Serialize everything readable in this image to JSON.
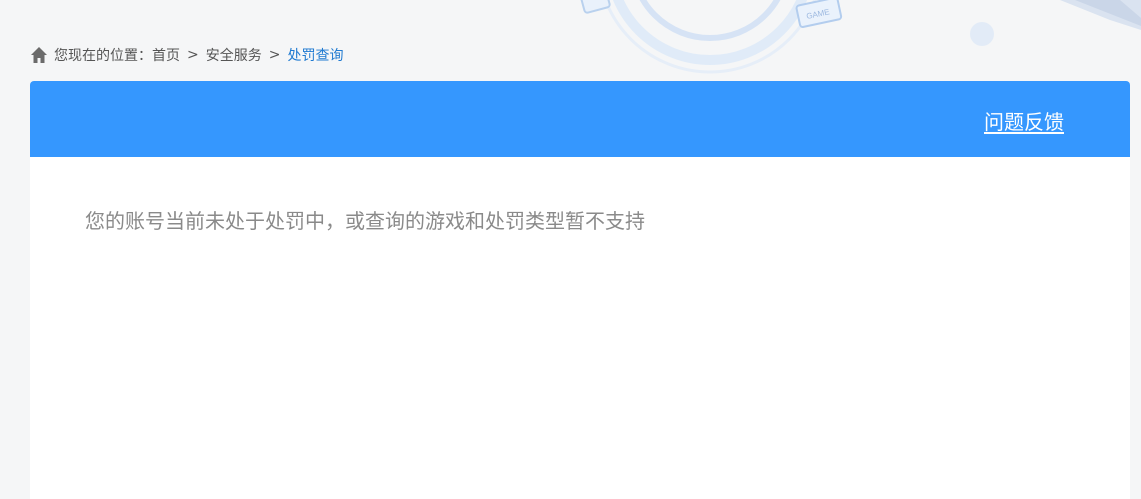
{
  "breadcrumb": {
    "icon": "home-icon",
    "prefix": "您现在的位置：",
    "separator": ">",
    "items": [
      "首页",
      "安全服务"
    ],
    "current": "处罚查询"
  },
  "panel": {
    "feedback_label": "问题反馈",
    "message": "您的账号当前未处于处罚中，或查询的游戏和处罚类型暂不支持"
  },
  "colors": {
    "header_blue": "#3597fe",
    "link_blue": "#1f7ad1",
    "message_gray": "#8a8a8a",
    "page_bg": "#f5f6f7"
  }
}
